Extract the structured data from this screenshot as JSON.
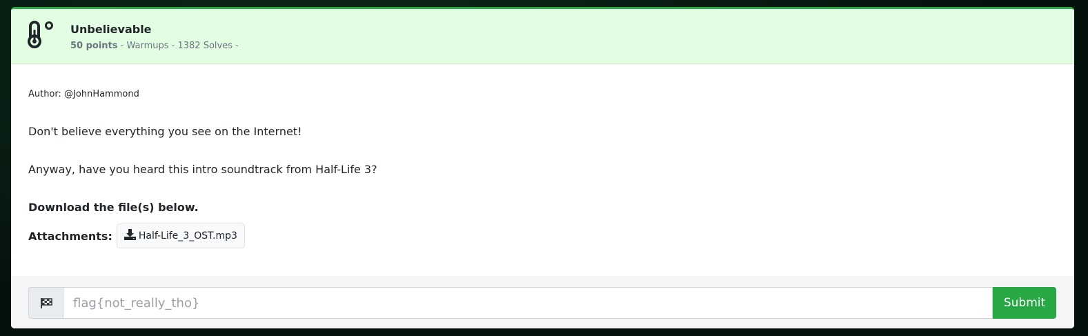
{
  "challenge": {
    "title": "Unbelievable",
    "points": "50 points",
    "meta": " - Warmups - 1382 Solves -",
    "icon": "thermometer-icon",
    "accent": "#28a745",
    "header_bg": "#e2fde2"
  },
  "description": {
    "author": "Author: @JohnHammond",
    "line1": "Don't believe everything you see on the Internet!",
    "line2": "Anyway, have you heard this intro soundtrack from Half-Life 3?",
    "download_note": "Download the file(s) below.",
    "attachments_label": "Attachments:",
    "attachments": [
      {
        "name": "Half-Life_3_OST.mp3",
        "icon": "download-icon"
      }
    ]
  },
  "flag_form": {
    "icon": "checkered-flag-icon",
    "placeholder": "flag{not_really_tho}",
    "value": "",
    "submit_label": "Submit"
  }
}
